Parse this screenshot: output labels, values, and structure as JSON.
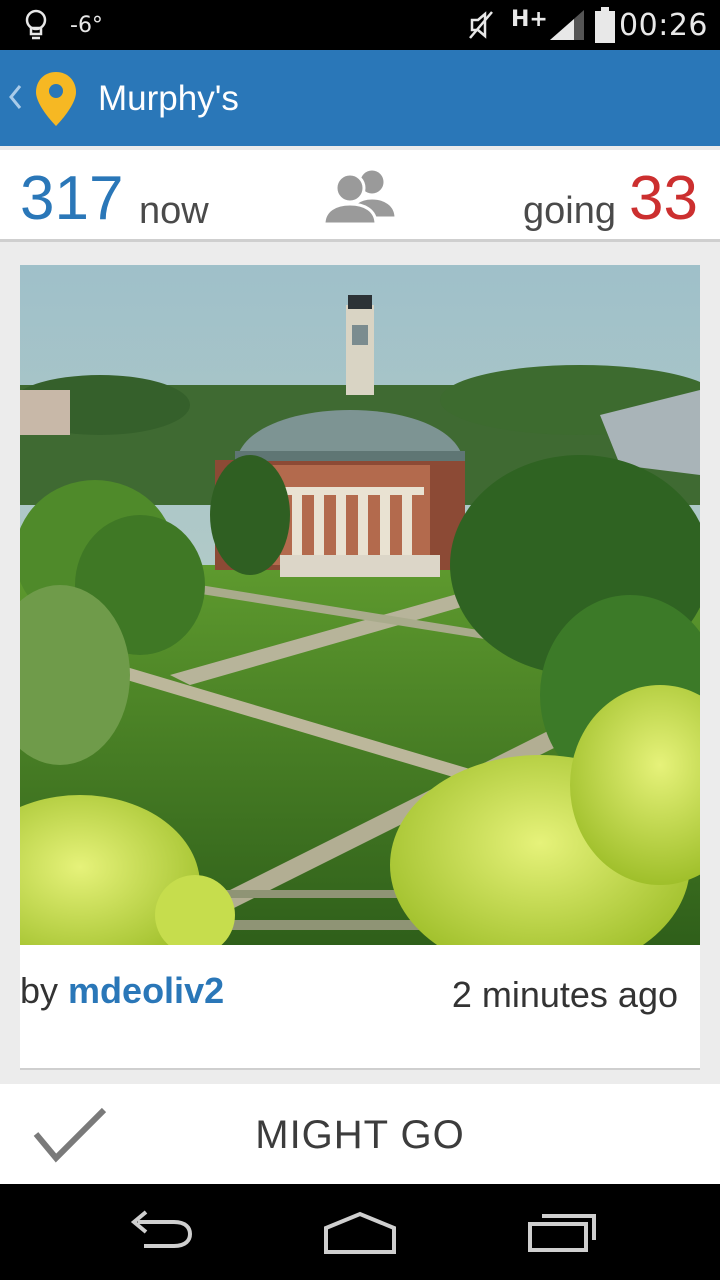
{
  "status_bar": {
    "temperature": "-6°",
    "network": "H+",
    "clock": "00:26",
    "icons": [
      "lightbulb-icon",
      "mute-icon",
      "signal-icon",
      "battery-icon"
    ]
  },
  "action_bar": {
    "title": "Murphy's",
    "icons": [
      "back-chevron-icon",
      "location-pin-icon"
    ],
    "pin_color": "#f6b823",
    "background_color": "#2a77b8"
  },
  "stats": {
    "now_count": "317",
    "now_label": "now",
    "going_label": "going",
    "going_count": "33",
    "now_color": "#2a77b8",
    "going_color": "#cc2f2f"
  },
  "post": {
    "by_prefix": "by",
    "author": "mdeoliv2",
    "time_ago": "2 minutes ago"
  },
  "rsvp": {
    "label": "MIGHT GO",
    "icon": "checkmark-icon"
  },
  "nav": {
    "icons": [
      "back-icon",
      "home-icon",
      "recents-icon"
    ]
  }
}
